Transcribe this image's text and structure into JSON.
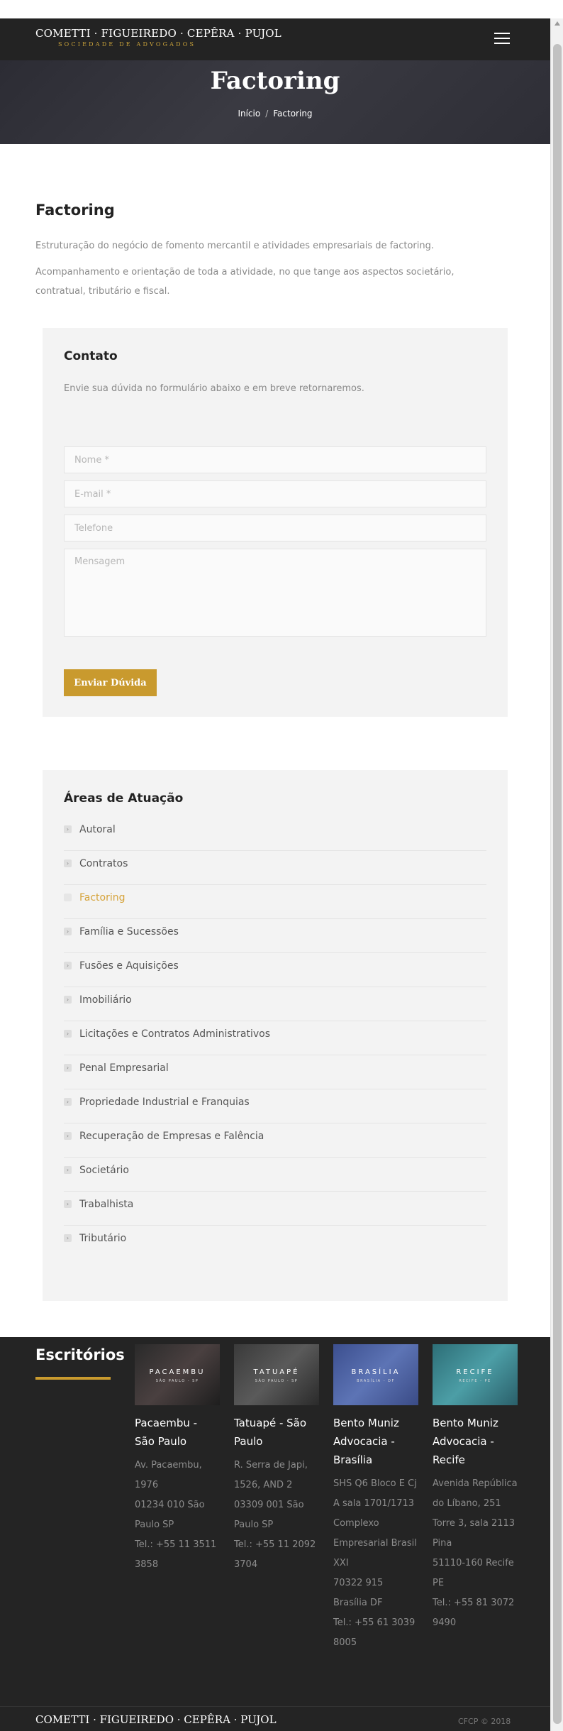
{
  "header": {
    "logo_main": "COMETTI · FIGUEIREDO · CEPÊRA · PUJOL",
    "logo_sub": "SOCIEDADE DE ADVOGADOS"
  },
  "hero": {
    "title": "Factoring",
    "breadcrumb_home": "Início",
    "breadcrumb_sep": "/",
    "breadcrumb_current": "Factoring"
  },
  "content": {
    "title": "Factoring",
    "para1": "Estruturação do negócio de fomento mercantil e atividades empresariais de factoring.",
    "para2": "Acompanhamento e orientação de toda a atividade, no que tange aos aspectos societário, contratual, tributário e fiscal."
  },
  "contact": {
    "title": "Contato",
    "description": "Envie sua dúvida no formulário abaixo e em breve retornaremos.",
    "name_placeholder": "Nome *",
    "email_placeholder": "E-mail *",
    "phone_placeholder": "Telefone",
    "message_placeholder": "Mensagem",
    "submit_label": "Enviar Dúvida"
  },
  "areas": {
    "title": "Áreas de Atuação",
    "items": [
      {
        "label": "Autoral"
      },
      {
        "label": "Contratos"
      },
      {
        "label": "Factoring",
        "active": true
      },
      {
        "label": "Família e Sucessões"
      },
      {
        "label": "Fusões e Aquisições"
      },
      {
        "label": "Imobiliário"
      },
      {
        "label": "Licitações e Contratos Administrativos"
      },
      {
        "label": "Penal Empresarial"
      },
      {
        "label": "Propriedade Industrial e Franquias"
      },
      {
        "label": "Recuperação de Empresas e Falência"
      },
      {
        "label": "Societário"
      },
      {
        "label": "Trabalhista"
      },
      {
        "label": "Tributário"
      }
    ]
  },
  "offices": {
    "title": "Escritórios",
    "list": [
      {
        "photo_label": "PACAEMBU",
        "photo_sub": "SÃO PAULO - SP",
        "name": "Pacaembu - São Paulo",
        "address": "Av. Pacaembu, 1976\n01234 010 São Paulo SP\nTel.: +55 11 3511 3858"
      },
      {
        "photo_label": "TATUAPÉ",
        "photo_sub": "SÃO PAULO - SP",
        "name": "Tatuapé - São Paulo",
        "address": "R. Serra de Japi, 1526, AND 2\n03309 001 São Paulo SP\nTel.: +55 11 2092 3704"
      },
      {
        "photo_label": "BRASÍLIA",
        "photo_sub": "BRASÍLIA - DF",
        "name": "Bento Muniz Advocacia - Brasília",
        "address": "SHS Q6 Bloco E Cj A sala 1701/1713\nComplexo Empresarial Brasil XXI\n70322 915 Brasília DF\nTel.: +55 61 3039 8005"
      },
      {
        "photo_label": "RECIFE",
        "photo_sub": "RECIFE - PE",
        "name": "Bento Muniz Advocacia - Recife",
        "address": "Avenida República do Líbano, 251 Torre 3, sala 2113 Pina\n51110-160 Recife PE\nTel.: +55 81 3072 9490"
      }
    ]
  },
  "footer": {
    "logo": "COMETTI · FIGUEIREDO · CEPÊRA · PUJOL",
    "copyright": "CFCP © 2018"
  }
}
